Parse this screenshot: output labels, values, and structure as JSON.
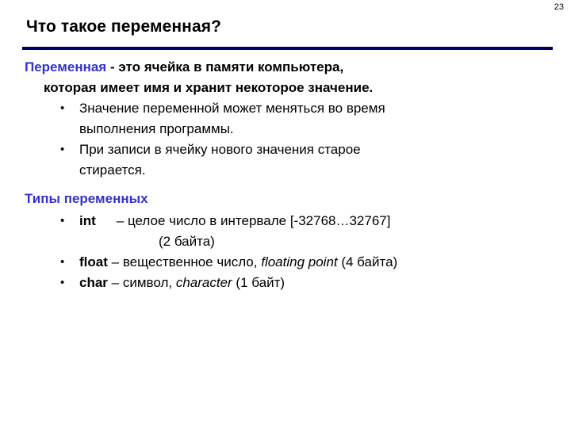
{
  "slide": {
    "page_number": "23",
    "title": "Что такое переменная?",
    "accent_color": "#3333cc",
    "rule_color": "#000066",
    "background_color": "#ffffff"
  },
  "definition": {
    "term": "Переменная",
    "line1_rest": " - это ячейка в памяти компьютера,",
    "line2": "которая имеет имя и хранит некоторое значение."
  },
  "bullets": [
    {
      "marker": "•",
      "line1": "Значение переменной может меняться во время",
      "line2": "выполнения программы."
    },
    {
      "marker": "•",
      "line1": "При записи в ячейку нового значения старое",
      "line2": "стирается."
    }
  ],
  "types_section": {
    "heading": "Типы переменных",
    "items": [
      {
        "marker": "•",
        "name": "int",
        "dash": "– ",
        "description": "целое число в интервале [-32768…32767]",
        "english": "",
        "size_note": "(2 байта)",
        "size_on_new_line": true
      },
      {
        "marker": "•",
        "name": "float",
        "dash": "– ",
        "description": "вещественное число, ",
        "english": "floating point",
        "size_note": " (4 байта)",
        "size_on_new_line": false
      },
      {
        "marker": "•",
        "name": "char",
        "dash": "– ",
        "description": "символ, ",
        "english": "character",
        "size_note": " (1 байт)",
        "size_on_new_line": false
      }
    ]
  }
}
